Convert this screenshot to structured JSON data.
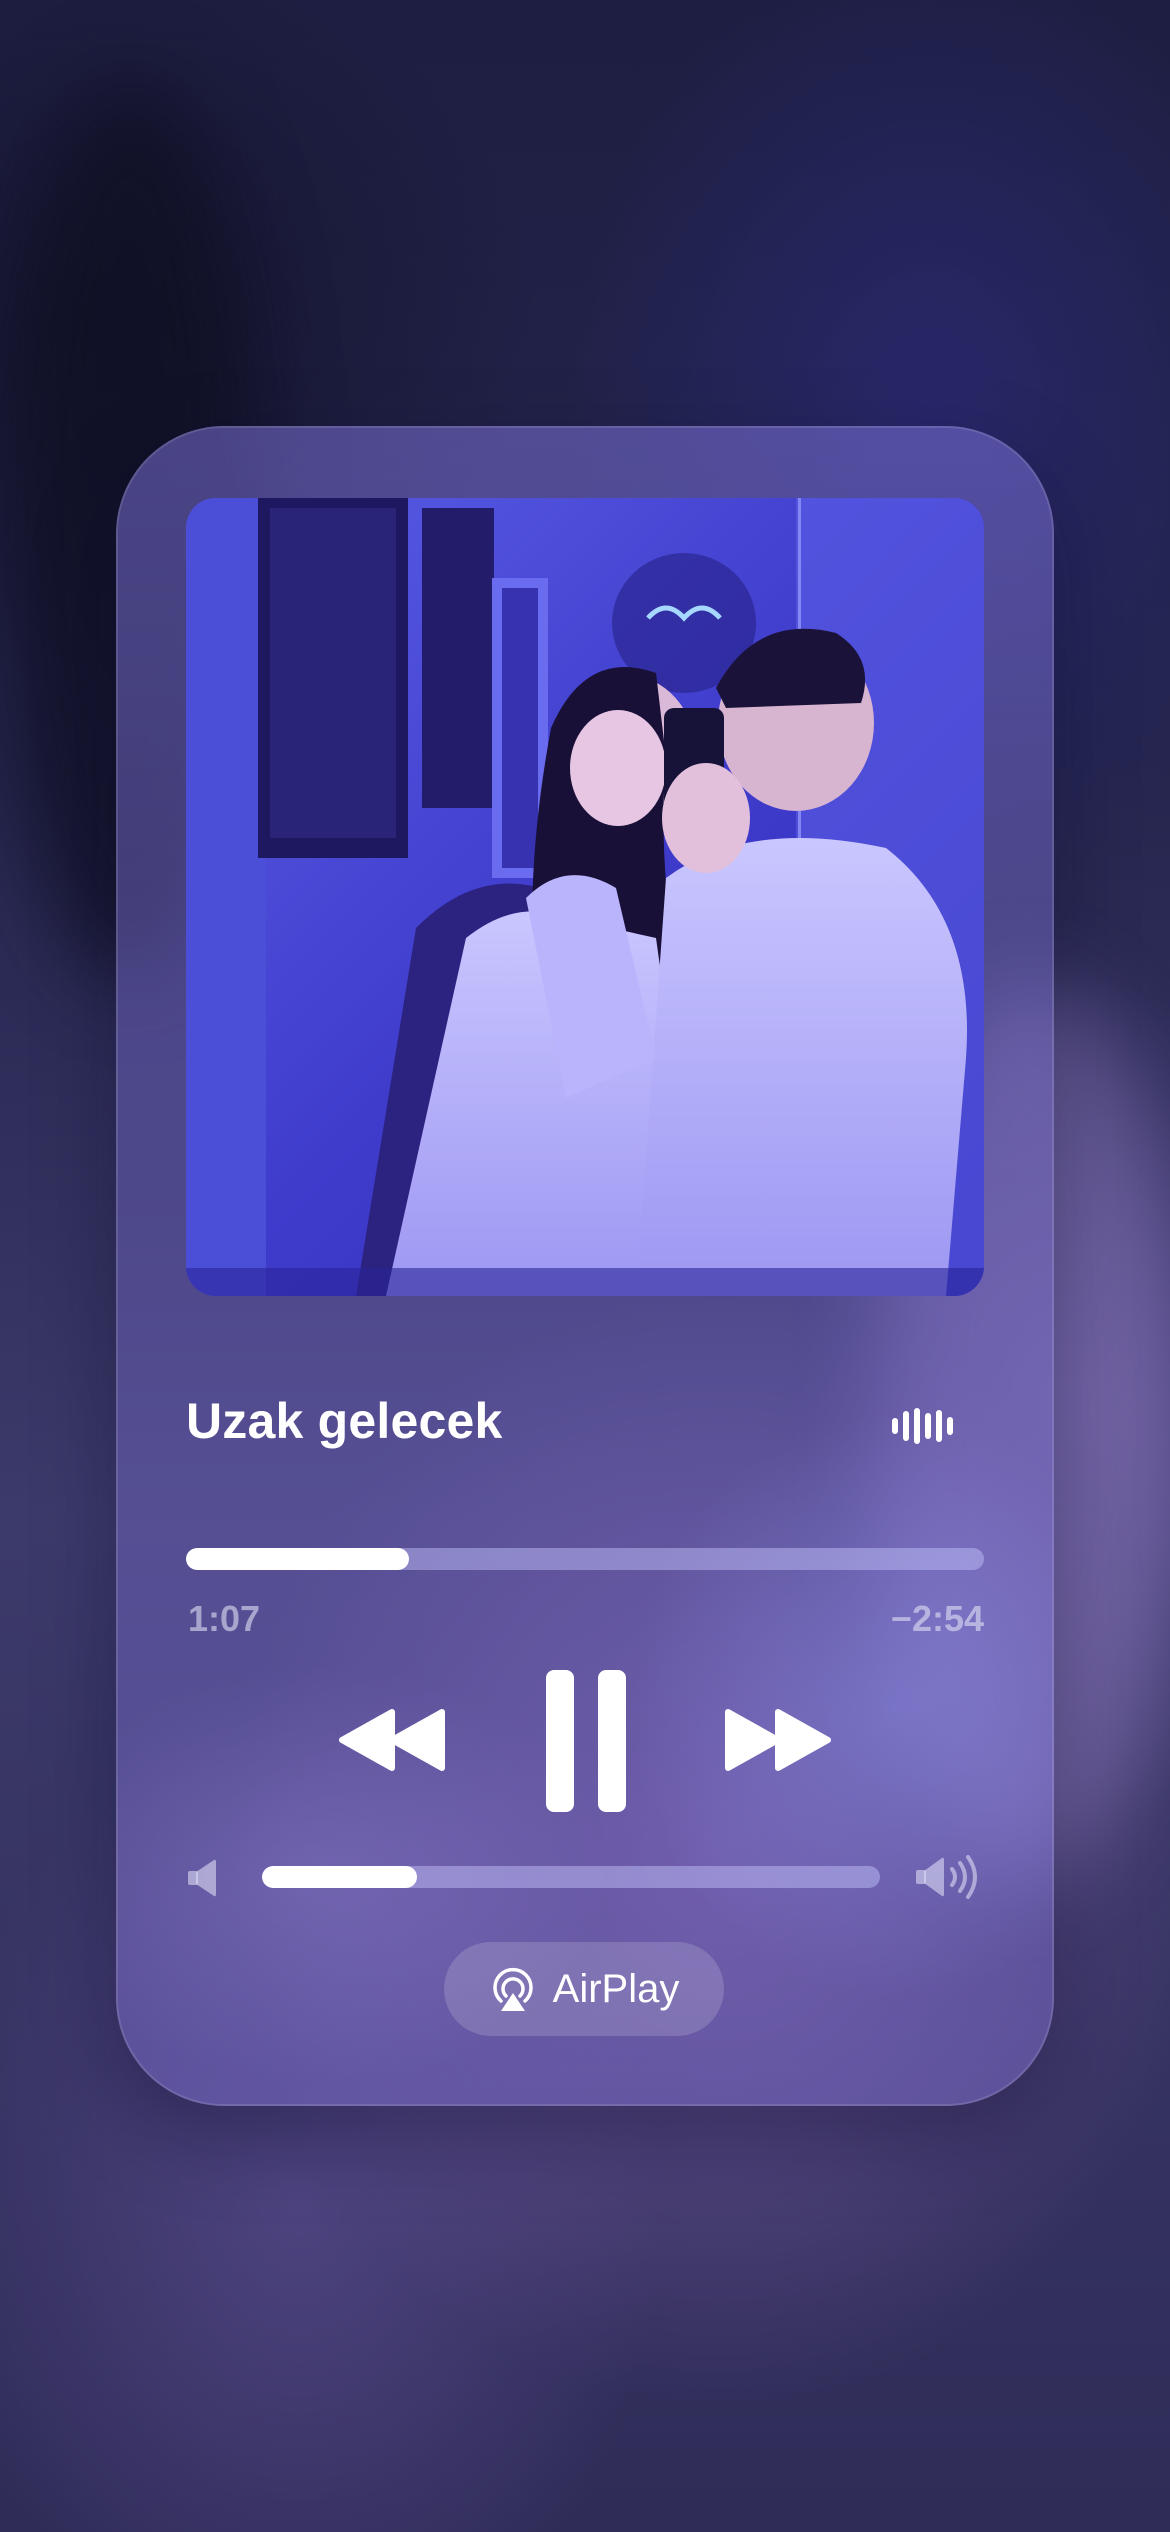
{
  "track": {
    "title": "Uzak gelecek",
    "progress": 0.28,
    "elapsed": "1:07",
    "remaining": "−2:54"
  },
  "controls": {
    "rewind_icon": "backward-icon",
    "pause_icon": "pause-icon",
    "forward_icon": "forward-icon",
    "waveform_icon": "audio-waveform-icon"
  },
  "volume": {
    "level": 0.25,
    "low_icon": "speaker-low-icon",
    "high_icon": "speaker-high-icon"
  },
  "airplay": {
    "label": "AirPlay",
    "icon": "airplay-icon"
  },
  "colors": {
    "accent": "#ffffff",
    "track_bg": "#c8c8ff",
    "card_tint": "#786ed2"
  }
}
